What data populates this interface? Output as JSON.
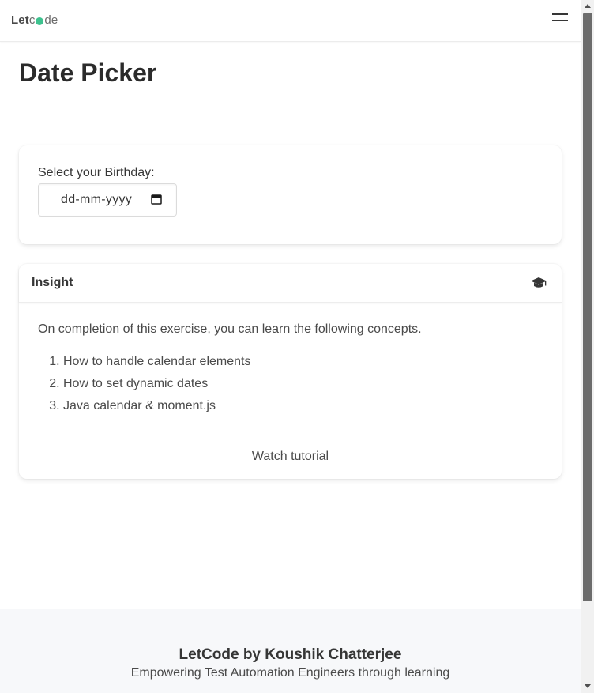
{
  "brand": {
    "logo_part1": "Let",
    "logo_part2": "de",
    "accent_color": "#3ec28f"
  },
  "navbar": {
    "menu_icon": "hamburger-icon"
  },
  "page": {
    "title": "Date Picker"
  },
  "date_picker": {
    "label": "Select your Birthday:",
    "placeholder": "dd-mm-yyyy",
    "value": "",
    "icon": "calendar-icon"
  },
  "insight": {
    "title": "Insight",
    "icon": "graduation-cap-icon",
    "intro": "On completion of this exercise, you can learn the following concepts.",
    "concepts": [
      "How to handle calendar elements",
      "How to set dynamic dates",
      "Java calendar & moment.js"
    ],
    "tutorial_link": "Watch tutorial"
  },
  "footer": {
    "title": "LetCode by Koushik Chatterjee",
    "subtitle": "Empowering Test Automation Engineers through learning"
  }
}
